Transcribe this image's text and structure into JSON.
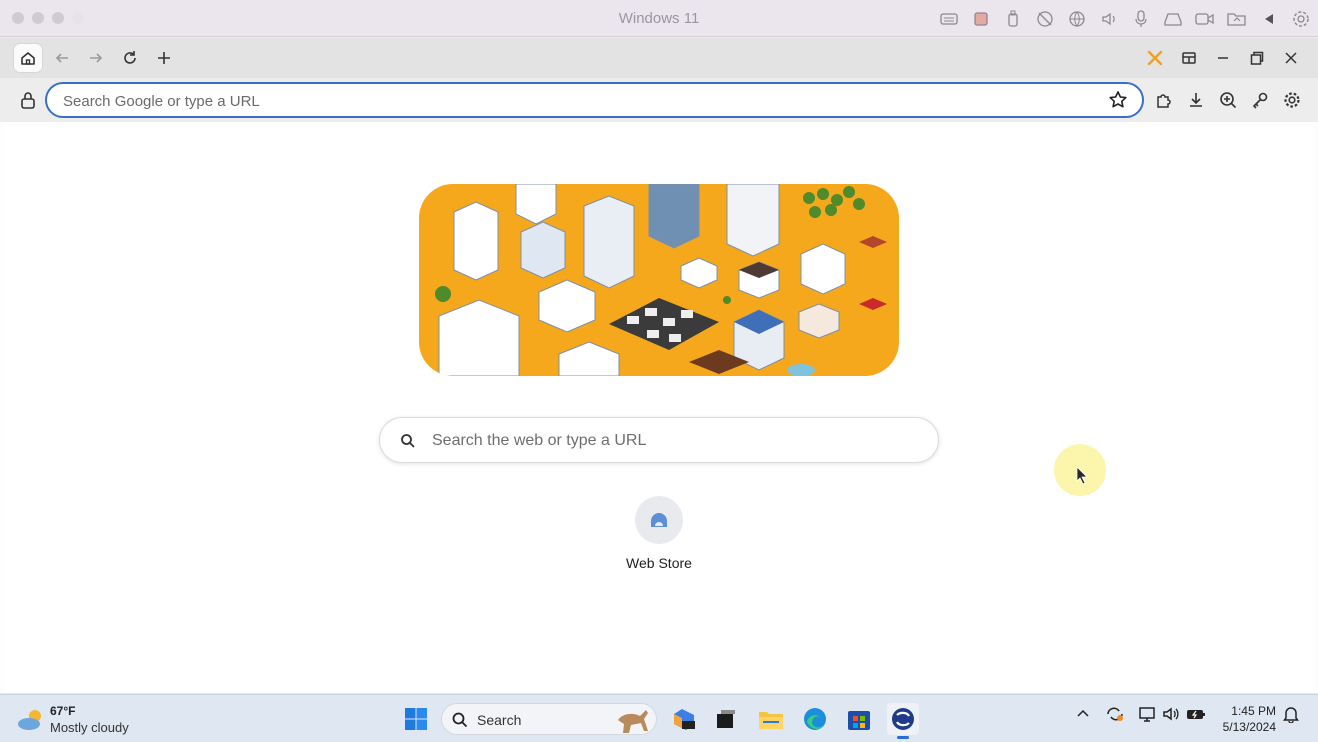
{
  "host": {
    "title": "Windows 11",
    "icons": [
      "keyboard-icon",
      "chip-icon",
      "usb-icon",
      "camera-off-icon",
      "globe-icon",
      "speaker-icon",
      "microphone-icon",
      "drive-icon",
      "video-camera-icon",
      "folder-share-icon",
      "triangle-left-icon",
      "gear-icon"
    ]
  },
  "browser": {
    "address_placeholder": "Search Google or type a URL",
    "address_value": ""
  },
  "newtab": {
    "search_placeholder": "Search the web or type a URL",
    "shortcuts": [
      {
        "label": "Web Store",
        "icon": "web-store-icon"
      }
    ]
  },
  "taskbar": {
    "weather_temp": "67°F",
    "weather_desc": "Mostly cloudy",
    "search_label": "Search",
    "time": "1:45 PM",
    "date": "5/13/2024"
  },
  "colors": {
    "accent": "#3a6fc9",
    "doodle_bg": "#f6a81c"
  }
}
